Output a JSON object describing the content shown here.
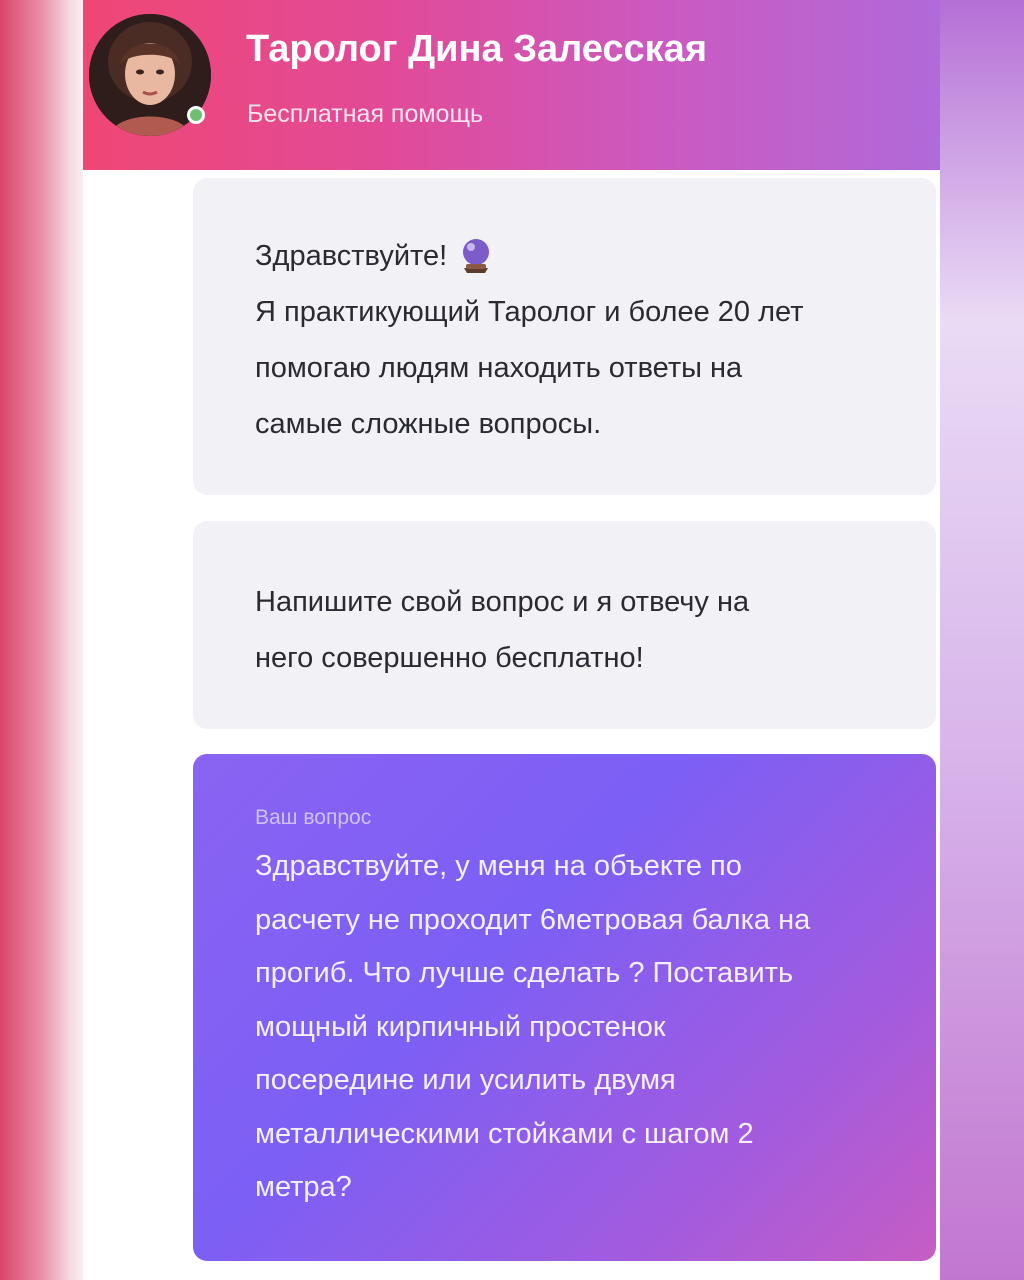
{
  "header": {
    "title": "Таролог Дина Залесская",
    "subtitle": "Бесплатная помощь",
    "status": "online"
  },
  "messages": [
    {
      "lines": [
        "Здравствуйте!",
        "Я практикующий Таролог и более 20 лет",
        "помогаю людям находить ответы на",
        "самые сложные вопросы."
      ],
      "icon": "crystal-ball-icon"
    },
    {
      "lines": [
        "Напишите свой вопрос и я отвечу на",
        "него совершенно бесплатно!"
      ]
    }
  ],
  "user_question": {
    "label": "Ваш вопрос",
    "lines": [
      "Здравствуйте, у меня на объекте по",
      "расчету не проходит 6метровая балка на",
      "прогиб. Что лучше сделать ? Поставить",
      "мощный кирпичный простенок",
      "посередине или усилить двумя",
      "металлическими стойками с шагом 2",
      "метра?"
    ]
  },
  "colors": {
    "header_start": "#ef4774",
    "header_end": "#b06ad9",
    "bubble_grey": "#f2f2f6",
    "question_start": "#8a63f2",
    "question_end": "#c65dc4",
    "online": "#6fbf73"
  }
}
